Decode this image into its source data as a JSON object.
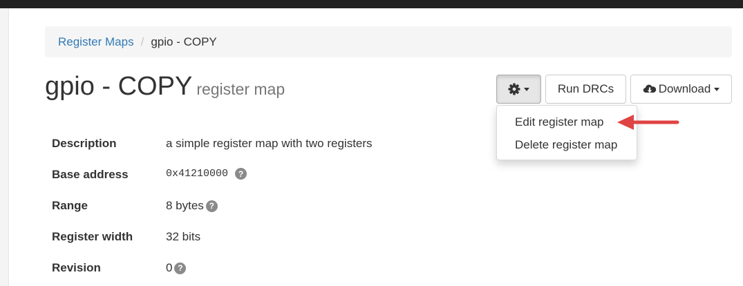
{
  "breadcrumb": {
    "items": [
      {
        "label": "Register Maps"
      },
      {
        "label": "gpio - COPY"
      }
    ],
    "separator": "/"
  },
  "header": {
    "title": "gpio - COPY",
    "subtitle": "register map"
  },
  "toolbar": {
    "gear_icon": "gear-icon",
    "run_drcs_label": "Run DRCs",
    "download_label": "Download",
    "download_icon": "cloud-download-icon"
  },
  "dropdown": {
    "items": [
      {
        "label": "Edit register map"
      },
      {
        "label": "Delete register map"
      }
    ]
  },
  "annotation": {
    "arrow_color": "#e04343"
  },
  "details": {
    "rows": [
      {
        "label": "Description",
        "value": "a simple register map with two registers"
      },
      {
        "label": "Base address",
        "value": "0x41210000"
      },
      {
        "label": "Range",
        "value": "8 bytes"
      },
      {
        "label": "Register width",
        "value": "32 bits"
      },
      {
        "label": "Revision",
        "value": "0"
      }
    ],
    "help_symbol": "?"
  }
}
